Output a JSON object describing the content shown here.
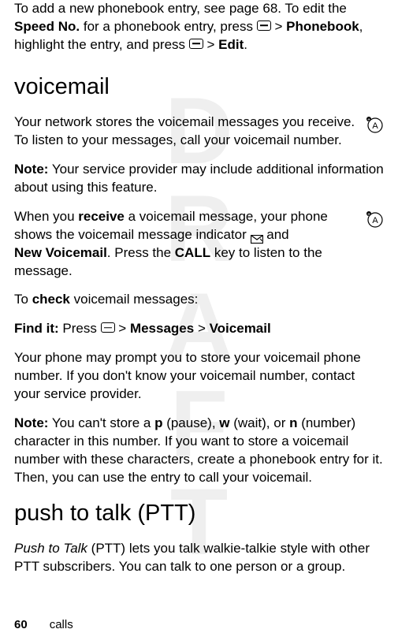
{
  "watermark": "DRAFT",
  "intro": {
    "text1": "To add a new phonebook entry, see page 68. To edit the ",
    "speedno": "Speed No.",
    "text2": " for a phonebook entry, press ",
    "gt1": " > ",
    "phonebook": "Phonebook",
    "text3": ", highlight the entry, and press ",
    "gt2": " > ",
    "edit": "Edit",
    "period": "."
  },
  "voicemail": {
    "heading": "voicemail",
    "p1": "Your network stores the voicemail messages you receive. To listen to your messages, call your voicemail number.",
    "note1_label": "Note:",
    "note1_text": " Your service provider may include additional information about using this feature.",
    "p2a": "When you ",
    "receive": "receive",
    "p2b": " a voicemail message, your phone shows the voicemail message indicator ",
    "p2c": " and ",
    "newvm": "New Voicemail",
    "p2d": ". Press the ",
    "call": "CALL",
    "p2e": " key to listen to the message.",
    "p3a": "To ",
    "check": "check",
    "p3b": " voicemail messages:",
    "findit": "Find it:",
    "findit_text": " Press ",
    "gt1": " > ",
    "messages": "Messages",
    "gt2": " > ",
    "voicemail_label": "Voicemail",
    "p4": "Your phone may prompt you to store your voicemail phone number. If you don't know your voicemail number, contact your service provider.",
    "note2_label": "Note:",
    "note2_a": " You can't store a ",
    "p_char": "p",
    "note2_b": " (pause), ",
    "w_char": "w",
    "note2_c": " (wait), or ",
    "n_char": "n",
    "note2_d": " (number) character in this number. If you want to store a voicemail number with these characters, create a phonebook entry for it. Then, you can use the entry to call your voicemail."
  },
  "ptt": {
    "heading": "push to talk (PTT)",
    "p1_italic": "Push to Talk",
    "p1_rest": "  (PTT) lets you talk walkie-talkie style with other PTT subscribers. You can talk to one person or a group."
  },
  "footer": {
    "page": "60",
    "section": "calls"
  }
}
